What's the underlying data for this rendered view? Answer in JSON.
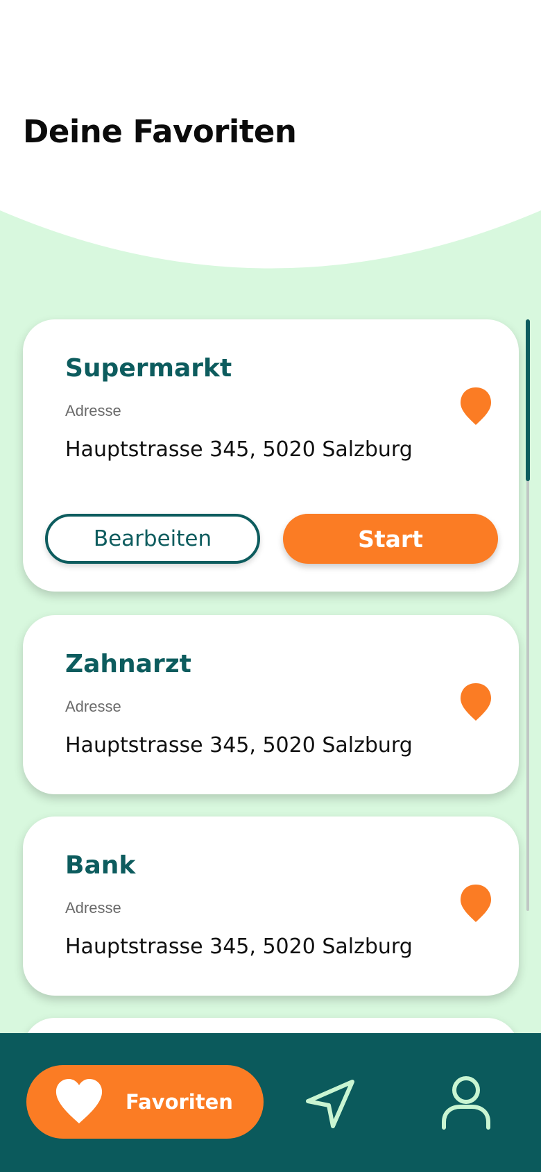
{
  "header": {
    "title": "Deine Favoriten"
  },
  "favorites": [
    {
      "name": "Supermarkt",
      "address_label": "Adresse",
      "address": "Hauptstrasse 345, 5020 Salzburg",
      "edit_label": "Bearbeiten",
      "start_label": "Start",
      "icon": "location-pin-icon"
    },
    {
      "name": "Zahnarzt",
      "address_label": "Adresse",
      "address": "Hauptstrasse 345, 5020 Salzburg",
      "icon": "location-pin-icon"
    },
    {
      "name": "Bank",
      "address_label": "Adresse",
      "address": "Hauptstrasse 345, 5020 Salzburg",
      "icon": "location-pin-icon"
    }
  ],
  "bottom_nav": {
    "favorites_label": "Favoriten",
    "favorites_icon": "heart-icon",
    "navigation_icon": "navigation-arrow-icon",
    "profile_icon": "user-icon",
    "active": "Favoriten"
  },
  "colors": {
    "background": "#d8f8de",
    "primary": "#0d5c5e",
    "accent": "#fb7c24",
    "card": "#ffffff",
    "nav_icon": "#c9f5d2"
  }
}
